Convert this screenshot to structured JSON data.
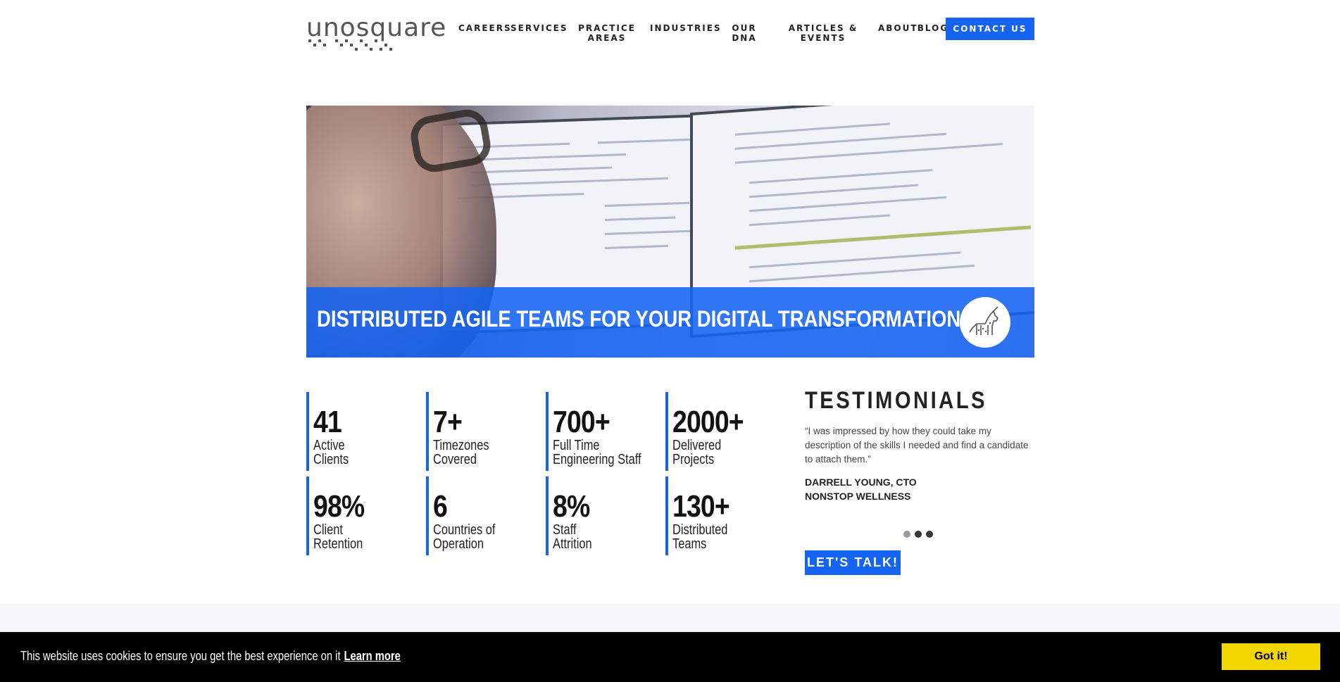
{
  "header": {
    "logo_text": "unosquare",
    "nav": [
      {
        "line1": "CAREERS",
        "line2": ""
      },
      {
        "line1": "SERVICES",
        "line2": ""
      },
      {
        "line1": "PRACTICE",
        "line2": "AREAS"
      },
      {
        "line1": "INDUSTRIES",
        "line2": ""
      },
      {
        "line1": "OUR",
        "line2": "DNA"
      },
      {
        "line1": "ARTICLES &",
        "line2": "EVENTS"
      },
      {
        "line1": "ABOUT",
        "line2": ""
      },
      {
        "line1": "BLOG",
        "line2": ""
      }
    ],
    "contact_label": "CONTACT US"
  },
  "hero": {
    "title": "DISTRIBUTED AGILE TEAMS FOR YOUR DIGITAL TRANSFORMATION"
  },
  "stats": [
    {
      "value": "41",
      "label1": "Active",
      "label2": "Clients"
    },
    {
      "value": "7+",
      "label1": "Timezones",
      "label2": "Covered"
    },
    {
      "value": "700+",
      "label1": "Full Time",
      "label2": "Engineering Staff"
    },
    {
      "value": "2000+",
      "label1": "Delivered",
      "label2": "Projects"
    },
    {
      "value": "98%",
      "label1": "Client",
      "label2": "Retention"
    },
    {
      "value": "6",
      "label1": "Countries of",
      "label2": "Operation"
    },
    {
      "value": "8%",
      "label1": "Staff",
      "label2": "Attrition"
    },
    {
      "value": "130+",
      "label1": "Distributed",
      "label2": "Teams"
    }
  ],
  "testimonials": {
    "title": "TESTIMONIALS",
    "quote": "“I was impressed by how they could take my description of the skills I needed and find a candidate to attach them.”",
    "author_name": "DARRELL YOUNG, CTO",
    "author_company": "NONSTOP WELLNESS",
    "cta_label": "LET'S TALK!"
  },
  "cookie": {
    "message": "This website uses cookies to ensure you get the best experience on it",
    "learn_more": "Learn more",
    "accept": "Got it!"
  },
  "colors": {
    "accent": "#1463f3",
    "cookie_button": "#f1d600"
  }
}
